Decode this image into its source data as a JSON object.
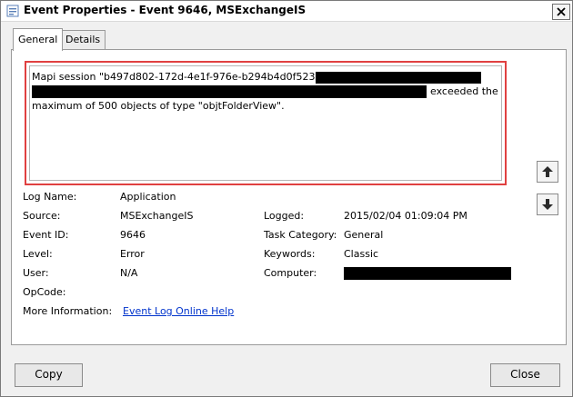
{
  "window": {
    "title": "Event Properties - Event 9646, MSExchangeIS"
  },
  "tabs": [
    {
      "label": "General"
    },
    {
      "label": "Details"
    }
  ],
  "description": {
    "line1": "Mapi session \"b497d802-172d-4e1f-976e-b294b4d0f523: /o=",
    "line2_suffix": "exceeded the",
    "line3": "maximum of 500 objects of type \"objtFolderView\"."
  },
  "fields": {
    "log_name_label": "Log Name:",
    "log_name_value": "Application",
    "source_label": "Source:",
    "source_value": "MSExchangeIS",
    "event_id_label": "Event ID:",
    "event_id_value": "9646",
    "level_label": "Level:",
    "level_value": "Error",
    "user_label": "User:",
    "user_value": "N/A",
    "opcode_label": "OpCode:",
    "opcode_value": "",
    "more_info_label": "More Information:",
    "more_info_link": "Event Log Online Help",
    "logged_label": "Logged:",
    "logged_value": "2015/02/04 01:09:04 PM",
    "task_category_label": "Task Category:",
    "task_category_value": "General",
    "keywords_label": "Keywords:",
    "keywords_value": "Classic",
    "computer_label": "Computer:"
  },
  "buttons": {
    "copy": "Copy",
    "close": "Close"
  },
  "icons": {
    "title": "event-viewer-icon",
    "close": "close-icon",
    "up": "arrow-up-icon",
    "down": "arrow-down-icon"
  }
}
